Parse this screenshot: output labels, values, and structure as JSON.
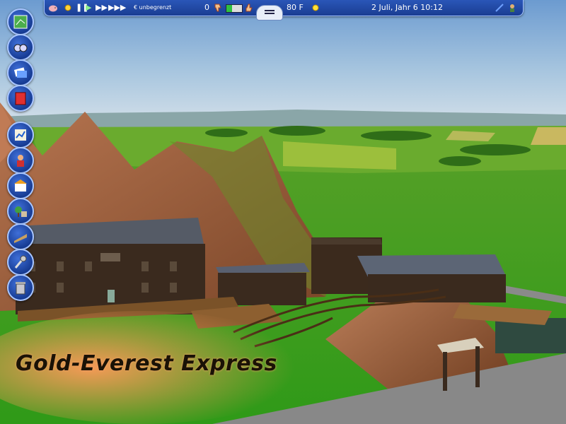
{
  "topbar": {
    "money": "€ unbegrenzt",
    "guests": "0",
    "temperature": "80 F",
    "date_time": "2 Juli, Jahr 6   10:12",
    "icons": [
      "piggy-bank-icon",
      "sun-speed-icon",
      "pause-icon",
      "play-icon",
      "fast-forward-icon",
      "fastest-forward-icon",
      "thumbs-down-icon",
      "thumbs-up-icon",
      "sun-weather-icon",
      "wand-icon",
      "advisor-icon",
      "menu-icon"
    ]
  },
  "toolbar": {
    "buttons": [
      "map-icon",
      "binoculars-icon",
      "tickets-icon",
      "book-icon",
      "chart-icon",
      "staff-icon",
      "shops-icon",
      "scenery-icon",
      "paths-icon",
      "terrain-tool-icon",
      "trash-icon"
    ]
  },
  "overlay": {
    "ride_name": "Gold-Everest Express"
  },
  "colors": {
    "sky": "#a8c8e0",
    "grass": "#3aa01e",
    "mountain": "#8a5030",
    "ui_blue": "#1f49a8"
  }
}
